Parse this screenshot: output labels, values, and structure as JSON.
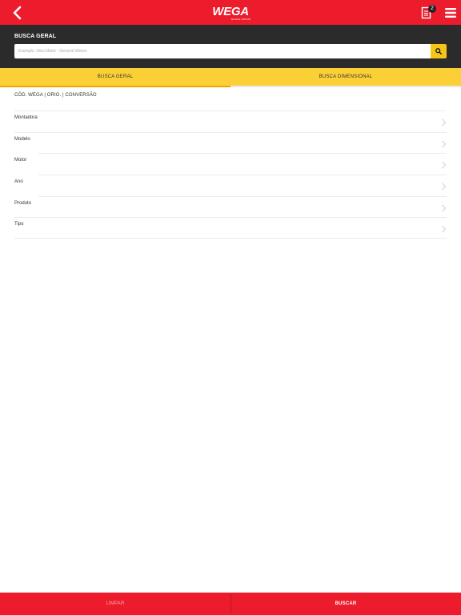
{
  "header": {
    "logo_text": "WEGA",
    "logo_tagline": "MAHLE GROUP",
    "cart_count": "2",
    "back_icon": "chevron-left-icon",
    "cart_icon": "document-list-icon",
    "menu_icon": "hamburger-menu-icon",
    "bar_color": "#ec1c2d"
  },
  "search": {
    "title": "BUSCA GERAL",
    "placeholder": "Exemplo: Óleo Motor - General Motors",
    "value": "",
    "button_icon": "search-icon",
    "button_color": "#f5c518"
  },
  "tabs": [
    {
      "label": "BUSCA GERAL",
      "active": true
    },
    {
      "label": "BUSCA DIMENSIONAL",
      "active": false
    }
  ],
  "code_link": "CÓD. WEGA | ORIG. | CONVERSÃO",
  "filters": [
    {
      "label": "Montadora"
    },
    {
      "label": "Modelo"
    },
    {
      "label": "Motor"
    },
    {
      "label": "Ano"
    },
    {
      "label": "Produto"
    },
    {
      "label": "Tipo"
    }
  ],
  "footer": {
    "clear_label": "LIMPAR",
    "search_label": "BUSCAR"
  }
}
